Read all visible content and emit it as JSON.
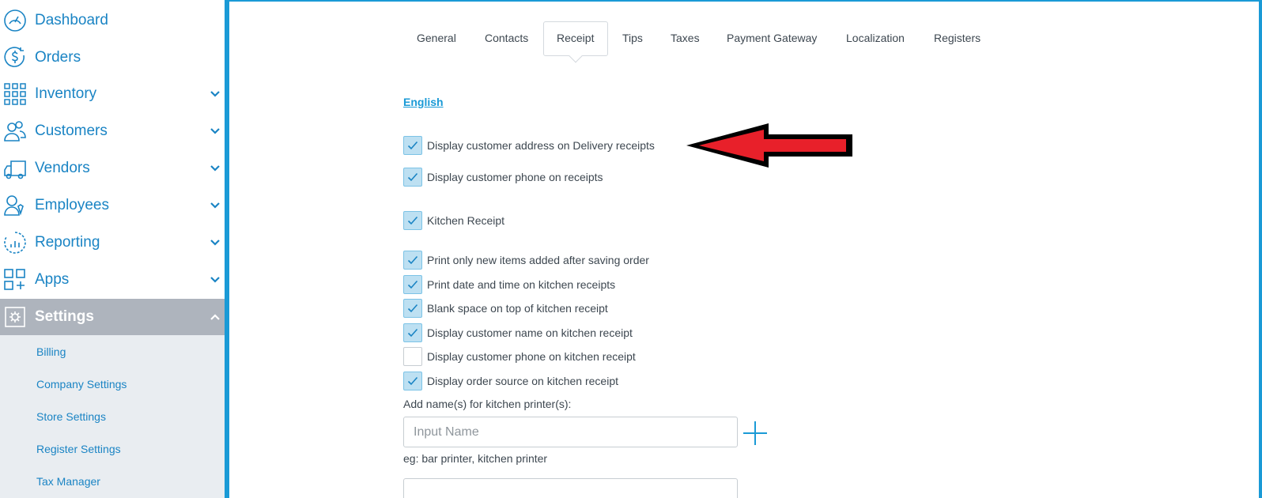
{
  "sidebar": {
    "items": [
      {
        "label": "Dashboard",
        "icon": "gauge-icon"
      },
      {
        "label": "Orders",
        "icon": "dollar-refresh-icon"
      },
      {
        "label": "Inventory",
        "icon": "grid-icon"
      },
      {
        "label": "Customers",
        "icon": "users-icon"
      },
      {
        "label": "Vendors",
        "icon": "truck-icon"
      },
      {
        "label": "Employees",
        "icon": "employee-icon"
      },
      {
        "label": "Reporting",
        "icon": "chart-circle-icon"
      },
      {
        "label": "Apps",
        "icon": "apps-icon"
      },
      {
        "label": "Settings",
        "icon": "gear-icon"
      }
    ],
    "sub_items": [
      "Billing",
      "Company Settings",
      "Store Settings",
      "Register Settings",
      "Tax Manager"
    ]
  },
  "tabs": [
    "General",
    "Contacts",
    "Receipt",
    "Tips",
    "Taxes",
    "Payment Gateway",
    "Localization",
    "Registers"
  ],
  "active_tab": "Receipt",
  "language_link": "English",
  "checkboxes": [
    {
      "label": "Display customer address on Delivery receipts",
      "checked": true
    },
    {
      "label": "Display customer phone on receipts",
      "checked": true
    },
    {
      "label": "Kitchen Receipt",
      "checked": true
    },
    {
      "label": "Print only new items added after saving order",
      "checked": true
    },
    {
      "label": "Print date and time on kitchen receipts",
      "checked": true
    },
    {
      "label": "Blank space on top of kitchen receipt",
      "checked": true
    },
    {
      "label": "Display customer name on kitchen receipt",
      "checked": true
    },
    {
      "label": "Display customer phone on kitchen receipt",
      "checked": false
    },
    {
      "label": "Display order source on kitchen receipt",
      "checked": true
    }
  ],
  "printer_field": {
    "label": "Add name(s) for kitchen printer(s):",
    "placeholder": "Input Name",
    "value": "",
    "hint": "eg: bar printer, kitchen printer"
  },
  "colors": {
    "accent": "#1a9ad6",
    "nav_text": "#1a84c4",
    "active_nav_bg": "#aeb4bd",
    "submenu_bg": "#e9edf1",
    "checkbox_fill": "#bde0f2",
    "arrow": "#e8202a"
  }
}
